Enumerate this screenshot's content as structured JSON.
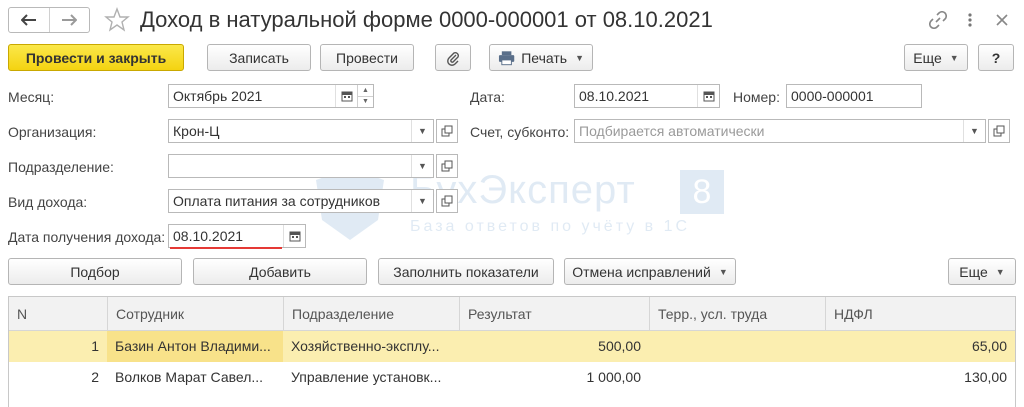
{
  "window": {
    "title": "Доход в натуральной форме 0000-000001 от 08.10.2021"
  },
  "toolbar": {
    "post_close": "Провести и закрыть",
    "save": "Записать",
    "post": "Провести",
    "print": "Печать",
    "more": "Еще",
    "help": "?"
  },
  "form": {
    "month_label": "Месяц:",
    "month_value": "Октябрь 2021",
    "date_label": "Дата:",
    "date_value": "08.10.2021",
    "number_label": "Номер:",
    "number_value": "0000-000001",
    "org_label": "Организация:",
    "org_value": "Крон-Ц",
    "account_label": "Счет, субконто:",
    "account_placeholder": "Подбирается автоматически",
    "dept_label": "Подразделение:",
    "dept_value": "",
    "income_type_label": "Вид дохода:",
    "income_type_value": "Оплата питания за сотрудников",
    "receipt_date_label": "Дата получения дохода:",
    "receipt_date_value": "08.10.2021"
  },
  "table_toolbar": {
    "pick": "Подбор",
    "add": "Добавить",
    "fill": "Заполнить показатели",
    "cancel_corrections": "Отмена исправлений",
    "more": "Еще"
  },
  "watermark": {
    "main": "БухЭксперт",
    "digit": "8",
    "sub": "База ответов по учёту в 1С"
  },
  "table": {
    "columns": [
      "N",
      "Сотрудник",
      "Подразделение",
      "Результат",
      "Терр., усл. труда",
      "НДФЛ"
    ],
    "rows": [
      {
        "n": "1",
        "employee": "Базин Антон Владими...",
        "dept": "Хозяйственно-эксплу...",
        "result": "500,00",
        "terr": "",
        "ndfl": "65,00",
        "selected": true
      },
      {
        "n": "2",
        "employee": "Волков Марат Савел...",
        "dept": "Управление установк...",
        "result": "1 000,00",
        "terr": "",
        "ndfl": "130,00",
        "selected": false
      }
    ]
  },
  "colors": {
    "primary_button": "#f4d311",
    "selected_row": "#fbeeb0",
    "required_underline": "#e53935"
  }
}
